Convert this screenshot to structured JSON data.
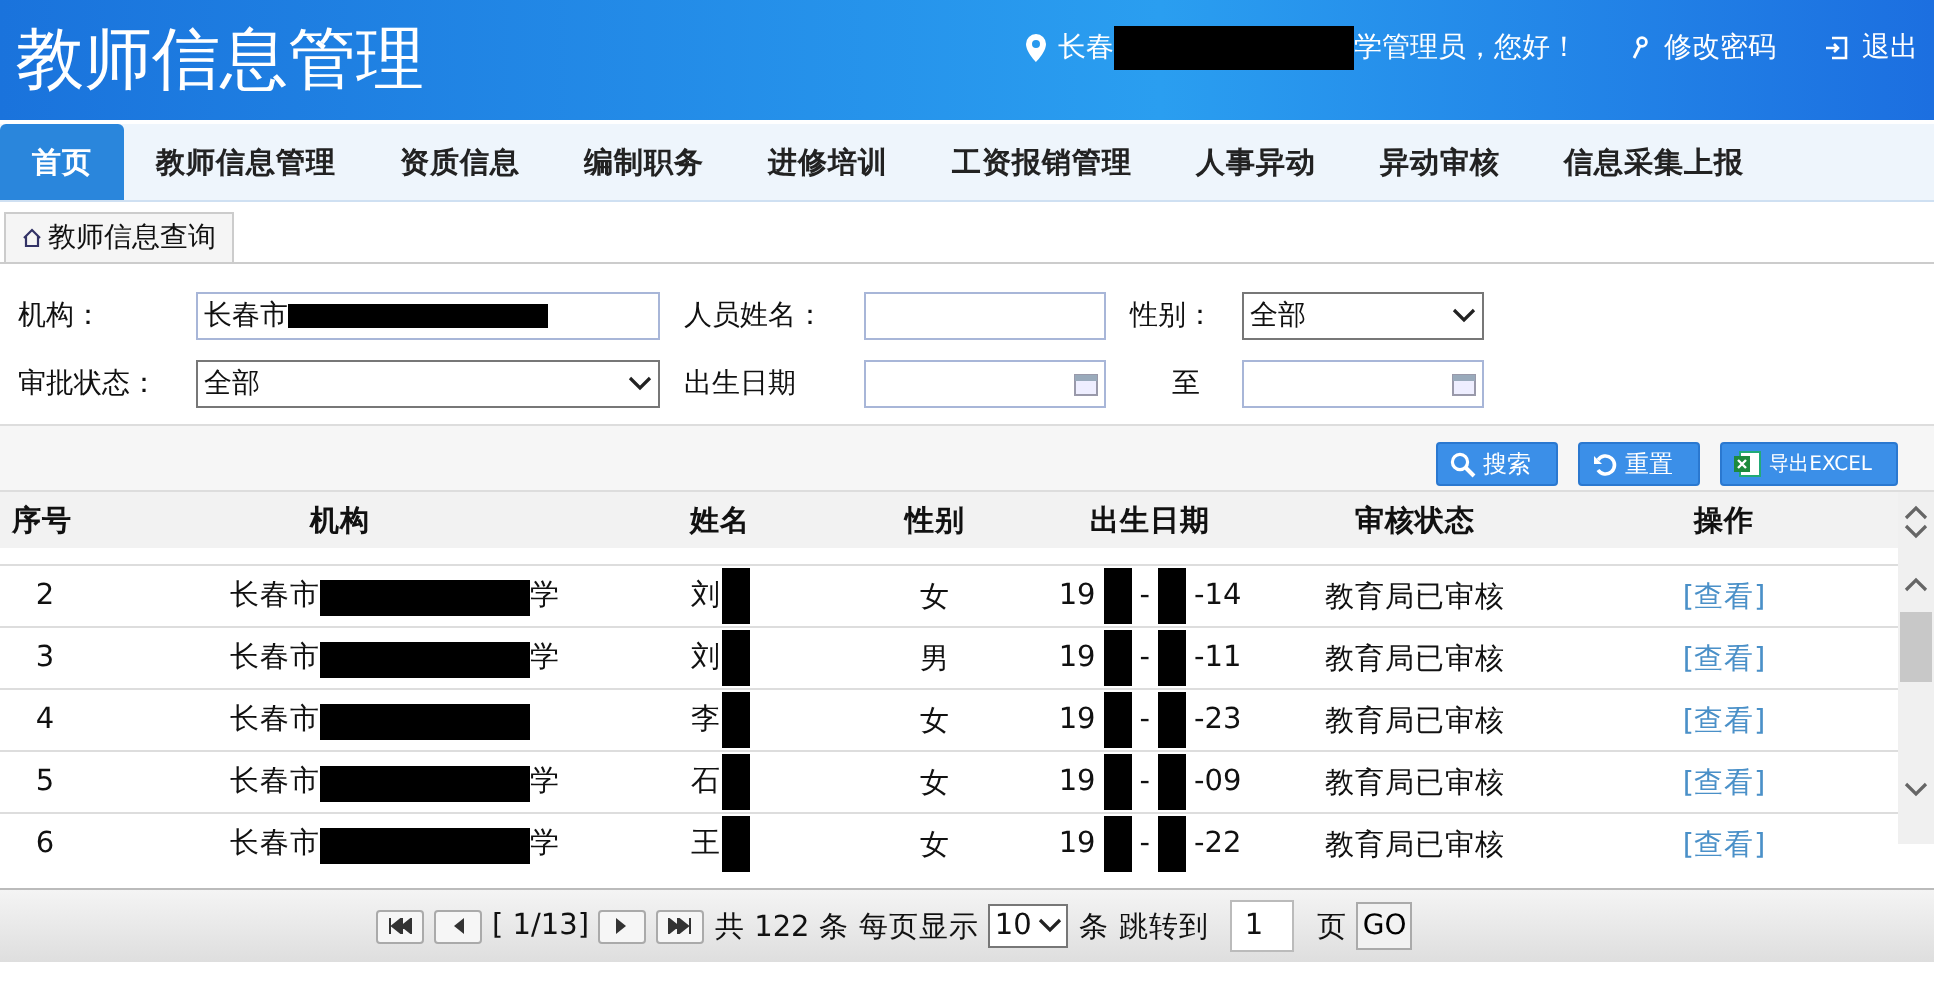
{
  "header": {
    "title": "教师信息管理",
    "user_parts": [
      "长春",
      "学管理员，您好！"
    ],
    "change_password": "修改密码",
    "logout": "退出"
  },
  "nav": [
    {
      "label": "首页",
      "selected": true
    },
    {
      "label": "教师信息管理",
      "selected": false
    },
    {
      "label": "资质信息",
      "selected": false
    },
    {
      "label": "编制职务",
      "selected": false
    },
    {
      "label": "进修培训",
      "selected": false
    },
    {
      "label": "工资报销管理",
      "selected": false
    },
    {
      "label": "人事异动",
      "selected": false
    },
    {
      "label": "异动审核",
      "selected": false
    },
    {
      "label": "信息采集上报",
      "selected": false
    }
  ],
  "page_tab": "教师信息查询",
  "filters": {
    "org_label": "机构：",
    "org_value_parts": [
      "长春市"
    ],
    "name_label": "人员姓名：",
    "gender_label": "性别：",
    "gender_value": "全部",
    "status_label": "审批状态：",
    "status_value": "全部",
    "birth_label": "出生日期",
    "birth_to": "至"
  },
  "buttons": [
    "搜索",
    "重置",
    "导出EXCEL"
  ],
  "table": {
    "columns": [
      "序号",
      "机构",
      "姓名",
      "性别",
      "出生日期",
      "审核状态",
      "操作"
    ],
    "rows": [
      {
        "no": "2",
        "org": "长春市",
        "org_suffix": "学",
        "name": "刘",
        "gender": "女",
        "birth_parts": [
          "19",
          "-",
          "-14"
        ],
        "status": "教育局已审核",
        "action": "[查看]"
      },
      {
        "no": "3",
        "org": "长春市",
        "org_suffix": "学",
        "name": "刘",
        "gender": "男",
        "birth_parts": [
          "19",
          "-",
          "-11"
        ],
        "status": "教育局已审核",
        "action": "[查看]"
      },
      {
        "no": "4",
        "org": "长春市",
        "name": "李",
        "gender": "女",
        "birth_parts": [
          "19",
          "-",
          "-23"
        ],
        "status": "教育局已审核",
        "action": "[查看]"
      },
      {
        "no": "5",
        "org": "长春市",
        "org_suffix": "学",
        "name": "石",
        "gender": "女",
        "birth_parts": [
          "19",
          "-",
          "-09"
        ],
        "status": "教育局已审核",
        "action": "[查看]"
      },
      {
        "no": "6",
        "org": "长春市",
        "org_suffix": "学",
        "name": "王",
        "gender": "女",
        "birth_parts": [
          "19",
          "-",
          "-22"
        ],
        "status": "教育局已审核",
        "action": "[查看]"
      }
    ]
  },
  "pager": {
    "page": "[ 1/13]",
    "total": "共 122 条",
    "per_page_label": "每页显示",
    "per_page": "10",
    "unit": "条",
    "goto_label": "跳转到",
    "goto_value": "1",
    "page_unit": "页",
    "go": "GO"
  }
}
